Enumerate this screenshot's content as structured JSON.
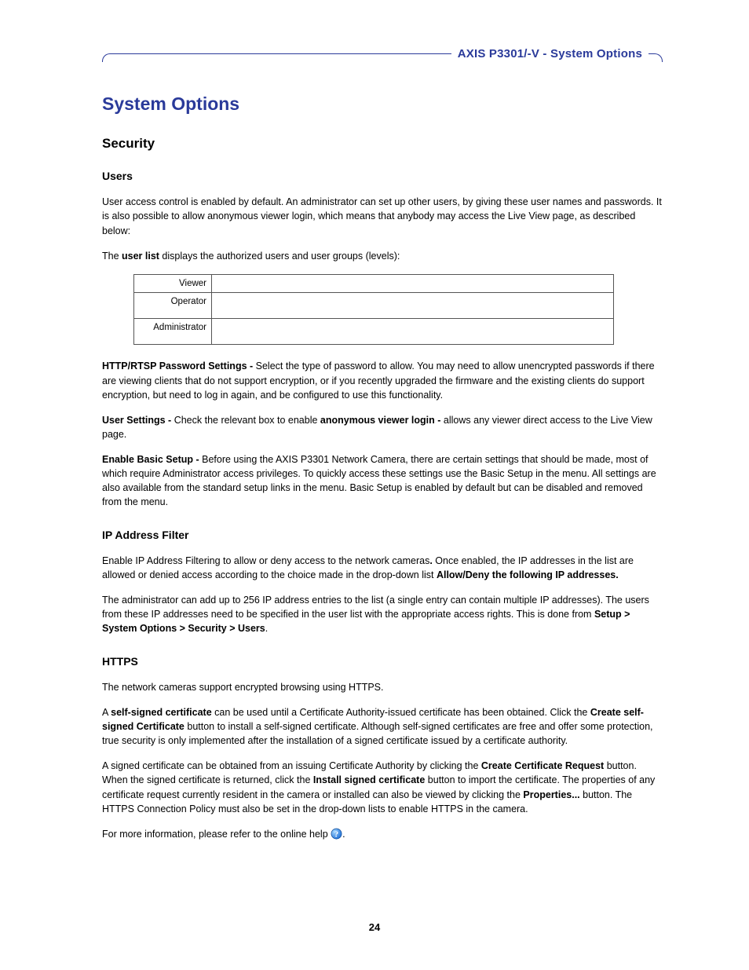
{
  "header": {
    "running_title": "AXIS P3301/-V - System Options"
  },
  "title": "System Options",
  "section_security": "Security",
  "users": {
    "heading": "Users",
    "p1": "User access control is enabled by default. An administrator can set up other users, by giving these user names and passwords. It is also possible to allow anonymous viewer login, which means that anybody may access the Live View page, as described below:",
    "p2_a": "The ",
    "p2_b": "user list",
    "p2_c": " displays the authorized users and user groups (levels):",
    "table": {
      "r1": "Viewer",
      "r2": "Operator",
      "r3": "Administrator"
    },
    "http_label": "HTTP/RTSP Password Settings - ",
    "http_text": "Select the type of password to allow. You may need to allow unencrypted passwords if there are viewing clients that do not support encryption, or if you recently upgraded the firmware and the existing clients do support encryption, but need to log in again, and be configured to use this functionality.",
    "usr_label": "User Settings - ",
    "usr_mid": "Check the relevant box to enable ",
    "usr_bold2": "anonymous viewer login - ",
    "usr_tail": "allows any viewer direct access to the Live View page.",
    "basic_label": "Enable Basic Setup - ",
    "basic_text": "Before using the AXIS P3301 Network Camera, there are certain settings that should be made, most of which require Administrator access privileges. To quickly access these settings use the Basic Setup in the menu. All settings are also available from the standard setup links in the menu. Basic Setup is enabled by default but can be disabled and removed from the menu."
  },
  "ipfilter": {
    "heading": "IP Address Filter",
    "p1_a": "Enable IP Address Filtering to allow or deny access to the network cameras",
    "p1_dot": ". ",
    "p1_b": "Once enabled, the IP addresses in the list are allowed or denied access according to the choice made in the drop-down list ",
    "p1_bold": "Allow/Deny the following IP addresses.",
    "p2_a": "The administrator can add up to 256 IP address entries to the list (a single entry can contain multiple IP addresses). The users from these IP addresses need to be specified in the user list with the appropriate access rights. This is done from ",
    "p2_bold": "Setup > System Options > Security > Users",
    "p2_tail": "."
  },
  "https": {
    "heading": "HTTPS",
    "p1": "The network cameras support encrypted browsing using HTTPS.",
    "p2_a": "A ",
    "p2_b1": "self-signed certificate",
    "p2_c": " can be used until a Certificate Authority-issued certificate has been obtained. Click the ",
    "p2_b2": "Create self-signed Certificate",
    "p2_d": " button to install a self-signed certificate. Although self-signed certificates are free and offer some protection, true security is only implemented after the installation of a signed certificate issued by a certificate authority.",
    "p3_a": "A signed certificate can be obtained from an issuing Certificate Authority by clicking the ",
    "p3_b1": "Create Certificate Request",
    "p3_b": " button. When the signed certificate is returned, click the ",
    "p3_b2": "Install signed certificate",
    "p3_c": " button to import the certificate. The properties of any certificate request currently resident in the camera or installed can also be viewed by clicking the ",
    "p3_b3": "Properties...",
    "p3_d": " button. The HTTPS Connection Policy must also be set in the drop-down lists to enable HTTPS in the camera.",
    "p4": "For more information, please refer to the online help ",
    "p4_tail": "."
  },
  "page_number": "24"
}
